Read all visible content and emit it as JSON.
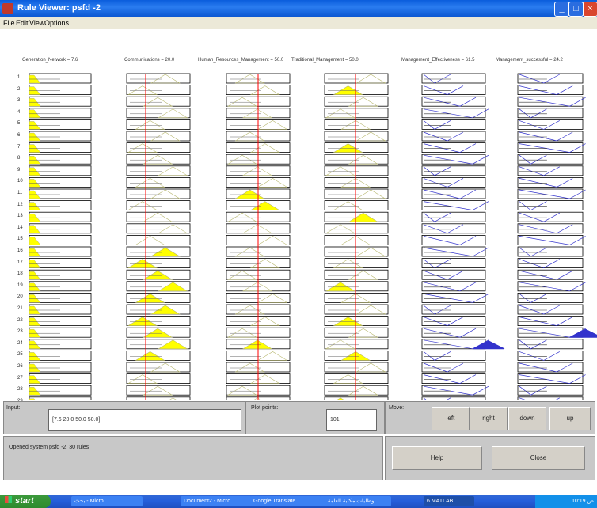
{
  "window": {
    "title": "Rule Viewer: psfd -2"
  },
  "menu": [
    "File",
    "Edit",
    "View",
    "Options"
  ],
  "variables": [
    {
      "label": "Generation_Network = 7.6"
    },
    {
      "label": "Communications = 20.0"
    },
    {
      "label": "Human_Resources_Management = 50.0"
    },
    {
      "label": "Traditional_Management = 50.0"
    },
    {
      "label": "Management_Effectiveness = 61.5"
    },
    {
      "label": "Management_successful = 24.2"
    }
  ],
  "rule_count": 30,
  "input_panel": {
    "label": "Input:",
    "value": "[7.6 20.0 50.0 50.0]"
  },
  "plot_points": {
    "label": "Plot points:",
    "value": "101"
  },
  "move_panel": {
    "label": "Move:",
    "buttons": [
      "left",
      "right",
      "down",
      "up"
    ]
  },
  "status_text": "Opened system psfd -2, 30 rules",
  "help_label": "Help",
  "close_label": "Close",
  "taskbar": {
    "start_label": "start",
    "tasks": [
      "بحث - Micro...",
      "Document2 - Micro...",
      "Google Translate...",
      "...وطلبات مكتبة العامة",
      "6 MATLAB"
    ],
    "clock": "10:19 ص"
  },
  "colors": {
    "titlebar": "#0a5ddc",
    "input_mf": "#ffff00",
    "output_mf": "#3333cc",
    "cursor_line": "#ff0000"
  }
}
